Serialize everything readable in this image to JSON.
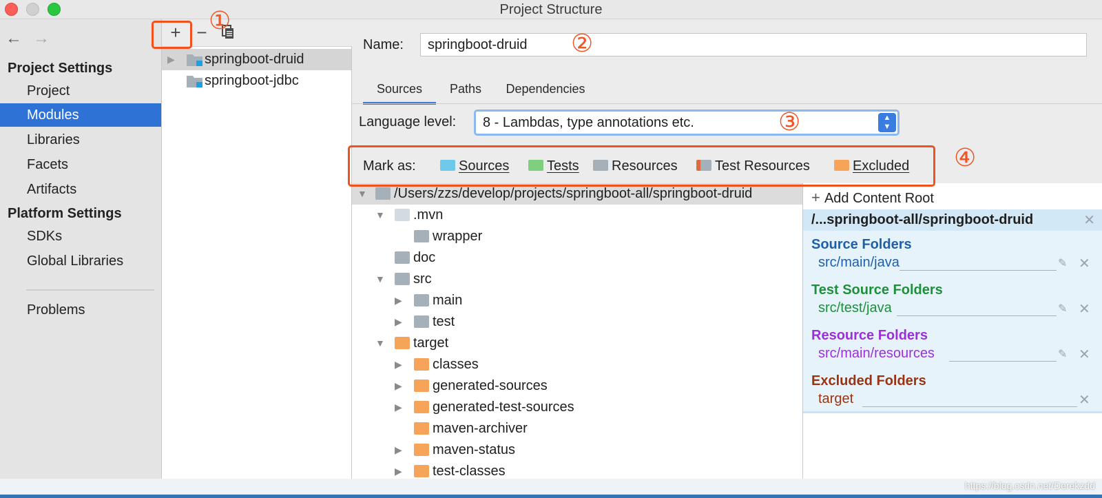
{
  "window": {
    "title": "Project Structure"
  },
  "sidebar": {
    "project_settings_title": "Project Settings",
    "project_items": [
      "Project",
      "Modules",
      "Libraries",
      "Facets",
      "Artifacts"
    ],
    "platform_settings_title": "Platform Settings",
    "platform_items": [
      "SDKs",
      "Global Libraries"
    ],
    "problems": "Problems",
    "selected": "Modules"
  },
  "modules": {
    "toolbar": {
      "add": "+",
      "remove": "−"
    },
    "items": [
      "springboot-druid",
      "springboot-jdbc"
    ],
    "selected": "springboot-druid"
  },
  "annotations": [
    "①",
    "②",
    "③",
    "④"
  ],
  "details": {
    "name_label": "Name:",
    "name_value": "springboot-druid",
    "tabs": [
      "Sources",
      "Paths",
      "Dependencies"
    ],
    "active_tab": "Sources",
    "language_level_label": "Language level:",
    "language_level_value": "8 - Lambdas, type annotations etc.",
    "mark_as_label": "Mark as:",
    "mark_as": [
      {
        "label": "Sources",
        "color": "#6ec9ea"
      },
      {
        "label": "Tests",
        "color": "#7fcf7f"
      },
      {
        "label": "Resources",
        "color": "#a6b0b8"
      },
      {
        "label": "Test Resources",
        "color": "#a6b0b8"
      },
      {
        "label": "Excluded",
        "color": "#f7a45b"
      }
    ]
  },
  "tree": {
    "root": "/Users/zzs/develop/projects/springboot-all/springboot-druid",
    "items": [
      ".mvn",
      "wrapper",
      "doc",
      "src",
      "main",
      "test",
      "target",
      "classes",
      "generated-sources",
      "generated-test-sources",
      "maven-archiver",
      "maven-status",
      "test-classes"
    ]
  },
  "content_root": {
    "add_label": "Add Content Root",
    "path": "/...springboot-all/springboot-druid",
    "groups": [
      {
        "title": "Source Folders",
        "path": "src/main/java",
        "color": "#1f5fa8"
      },
      {
        "title": "Test Source Folders",
        "path": "src/test/java",
        "color": "#1e8f3a"
      },
      {
        "title": "Resource Folders",
        "path": "src/main/resources",
        "color": "#9b30d9"
      },
      {
        "title": "Excluded Folders",
        "path": "target",
        "color": "#9a3312"
      }
    ]
  },
  "credit": "https://blog.csdn.net/Derekzdd",
  "colors": {
    "accent": "#2f72d6",
    "highlight": "#f2501f",
    "excluded_folder": "#f7a45b",
    "plain_folder": "#a6b0b8"
  }
}
